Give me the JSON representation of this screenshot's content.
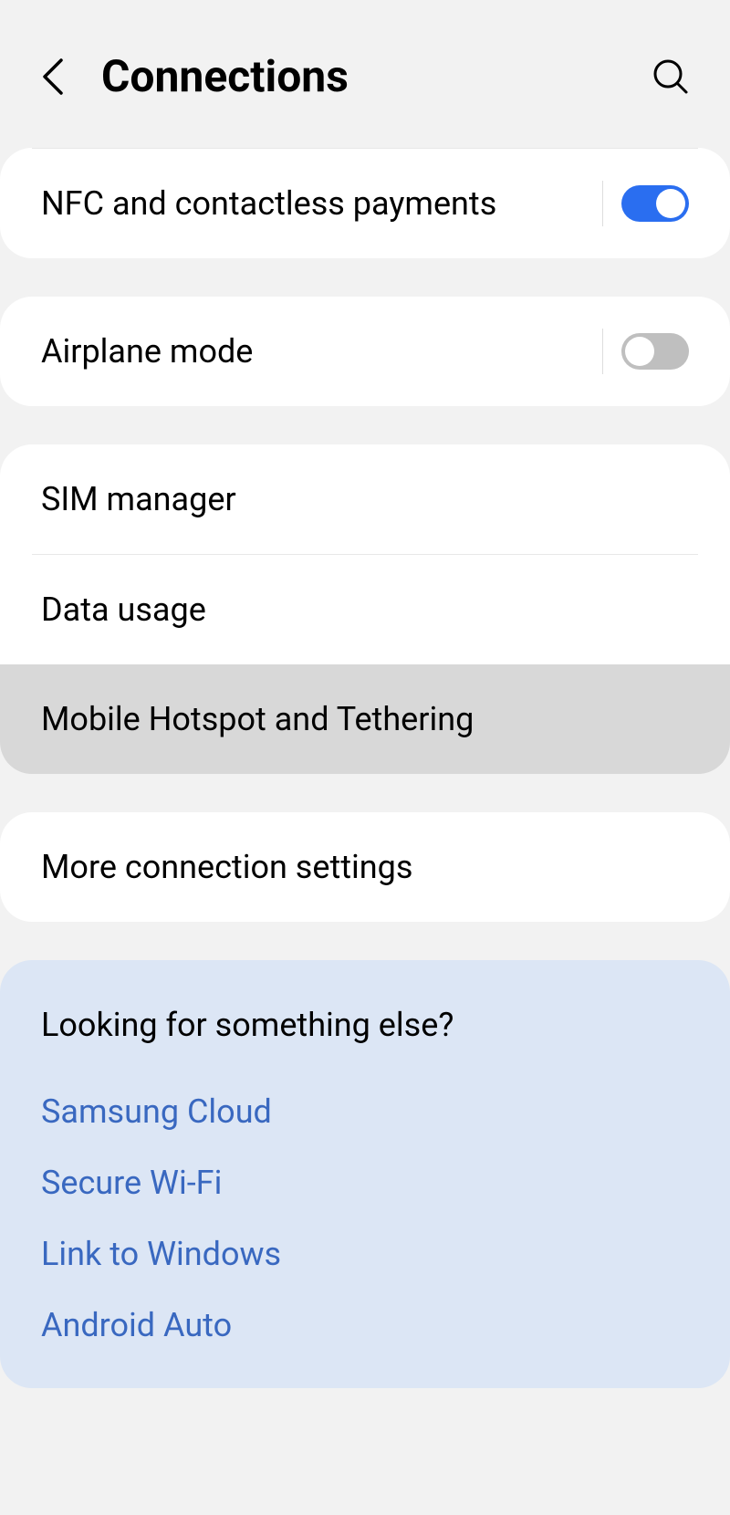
{
  "header": {
    "title": "Connections"
  },
  "nfc": {
    "label": "NFC and contactless payments",
    "enabled": true
  },
  "airplane": {
    "label": "Airplane mode",
    "enabled": false
  },
  "sim": {
    "label": "SIM manager"
  },
  "data": {
    "label": "Data usage"
  },
  "hotspot": {
    "label": "Mobile Hotspot and Tethering"
  },
  "more": {
    "label": "More connection settings"
  },
  "suggestions": {
    "title": "Looking for something else?",
    "links": {
      "samsung_cloud": "Samsung Cloud",
      "secure_wifi": "Secure Wi-Fi",
      "link_windows": "Link to Windows",
      "android_auto": "Android Auto"
    }
  }
}
